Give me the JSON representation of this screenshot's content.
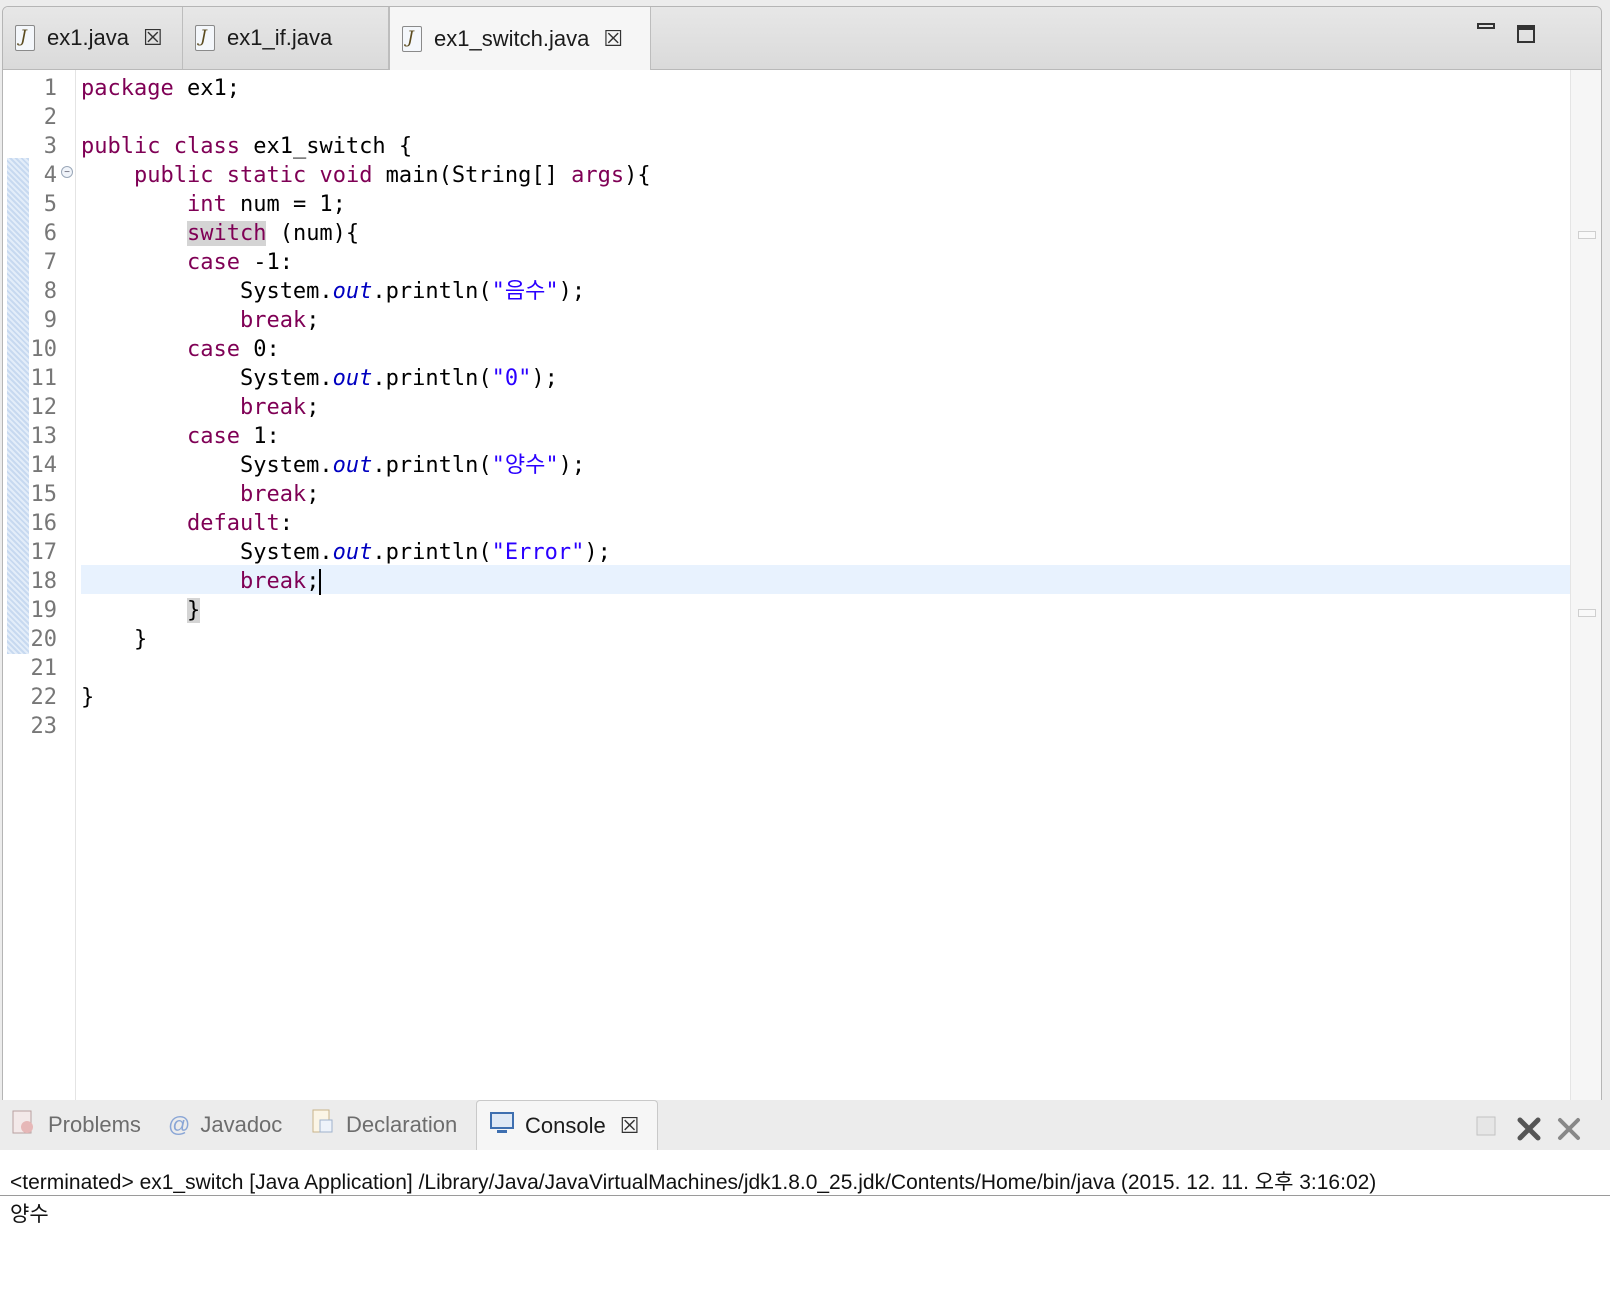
{
  "editor": {
    "tabs": [
      {
        "label": "ex1.java",
        "active": false,
        "closable": true
      },
      {
        "label": "ex1_if.java",
        "active": false,
        "closable": false
      },
      {
        "label": "ex1_switch.java",
        "active": true,
        "closable": true
      }
    ],
    "close_glyph": "☒",
    "current_line": 18,
    "line_numbers": [
      "1",
      "2",
      "3",
      "4",
      "5",
      "6",
      "7",
      "8",
      "9",
      "10",
      "11",
      "12",
      "13",
      "14",
      "15",
      "16",
      "17",
      "18",
      "19",
      "20",
      "21",
      "22",
      "23"
    ],
    "code": {
      "l1_kw": "package",
      "l1_rest": " ex1;",
      "l3_kw1": "public",
      "l3_kw2": "class",
      "l3_rest": " ex1_switch {",
      "l4_kw1": "public",
      "l4_kw2": "static",
      "l4_kw3": "void",
      "l4_mid": " main(String[] ",
      "l4_args": "args",
      "l4_end": "){",
      "l5_kw": "int",
      "l5_rest": " num = 1;",
      "l6_kw": "switch",
      "l6_rest": " (num){",
      "case_kw": "case",
      "l7_rest": " -1:",
      "l10_rest": " 0:",
      "l13_rest": " 1:",
      "system": "System.",
      "out": "out",
      "println": ".println(",
      "l8_str": "\"음수\"",
      "l11_str": "\"0\"",
      "l14_str": "\"양수\"",
      "l17_str": "\"Error\"",
      "stmt_end": ");",
      "break_kw": "break",
      "semicolon": ";",
      "l16_kw": "default",
      "colon": ":",
      "l19": "}",
      "l20": "}",
      "l22": "}"
    }
  },
  "console": {
    "tabs": [
      {
        "label": "Problems",
        "icon": "problems-icon"
      },
      {
        "label": "Javadoc",
        "icon": "javadoc-icon"
      },
      {
        "label": "Declaration",
        "icon": "declaration-icon"
      },
      {
        "label": "Console",
        "icon": "console-icon",
        "active": true
      }
    ],
    "status": "<terminated> ex1_switch [Java Application] /Library/Java/JavaVirtualMachines/jdk1.8.0_25.jdk/Contents/Home/bin/java (2015. 12. 11. 오후 3:16:02)",
    "output": "양수"
  }
}
